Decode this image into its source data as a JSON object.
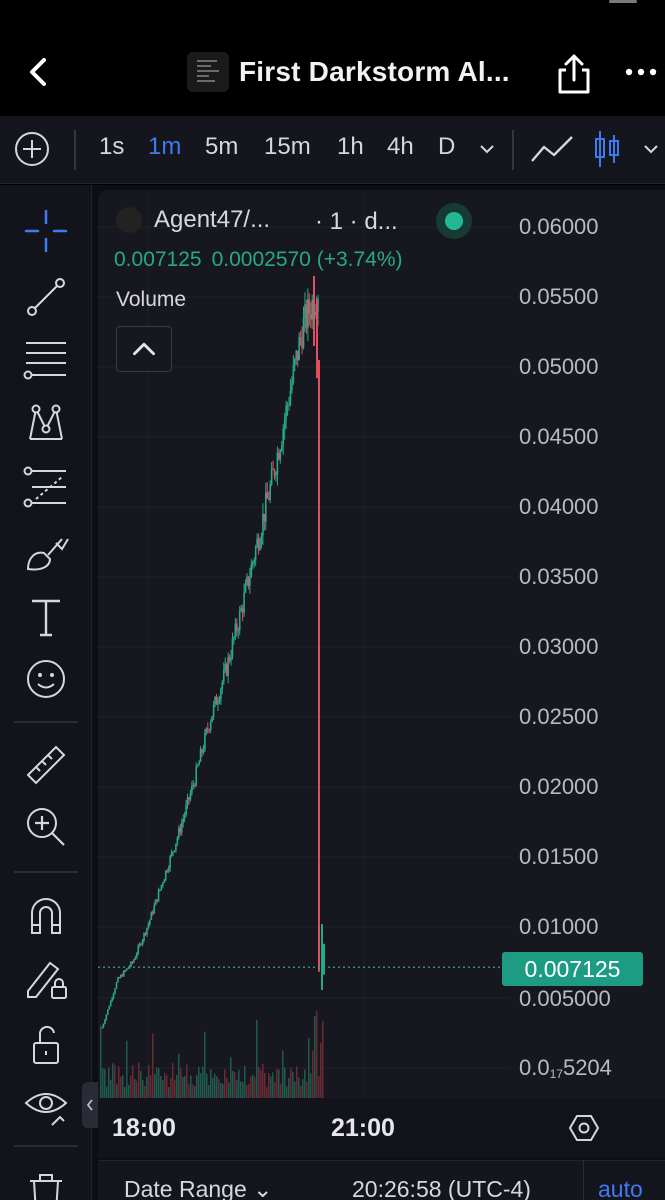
{
  "header": {
    "title": "First Darkstorm Al...",
    "back_icon": "chevron-left-icon",
    "share_icon": "share-icon",
    "more_icon": "more-icon"
  },
  "timeframes": {
    "items": [
      "1s",
      "1m",
      "5m",
      "15m",
      "1h",
      "4h",
      "D"
    ],
    "active": "1m"
  },
  "legend": {
    "symbol": "Agent47/...",
    "interval": "· 1 · d...",
    "open": "0.007125",
    "change": "0.0002570 (+3.74%)",
    "volume_label": "Volume"
  },
  "price_axis": {
    "labels": [
      "0.06000",
      "0.05500",
      "0.05000",
      "0.04500",
      "0.04000",
      "0.03500",
      "0.03000",
      "0.02500",
      "0.02000",
      "0.01500",
      "0.01000",
      "0.005000"
    ],
    "bottom_label_prefix": "0.0",
    "bottom_label_sub": "17",
    "bottom_label_suffix": "5204",
    "current_price": "0.007125"
  },
  "time_axis": {
    "labels": [
      "18:00",
      "21:00"
    ]
  },
  "bottom_bar": {
    "date_range": "Date Range",
    "clock": "20:26:58 (UTC-4)",
    "auto": "auto"
  },
  "colors": {
    "up": "#26a98b",
    "down": "#e04f5f",
    "accent": "#3d7bf3",
    "price_badge": "#1e9c83"
  },
  "chart_data": {
    "type": "candlestick",
    "ylim": [
      0.0,
      0.062
    ],
    "x": [
      "17:50",
      "18:00",
      "18:10",
      "18:20",
      "18:30",
      "18:40",
      "18:50",
      "19:00",
      "19:10",
      "19:20",
      "19:30",
      "19:40",
      "19:50",
      "20:00",
      "20:10",
      "20:20",
      "20:25",
      "20:26"
    ],
    "close": [
      0.0028,
      0.0062,
      0.0075,
      0.0102,
      0.0135,
      0.0168,
      0.0205,
      0.0248,
      0.0282,
      0.0325,
      0.0372,
      0.0418,
      0.0472,
      0.0528,
      0.0556,
      0.0495,
      0.0068,
      0.007125
    ],
    "last_price": 0.007125
  }
}
